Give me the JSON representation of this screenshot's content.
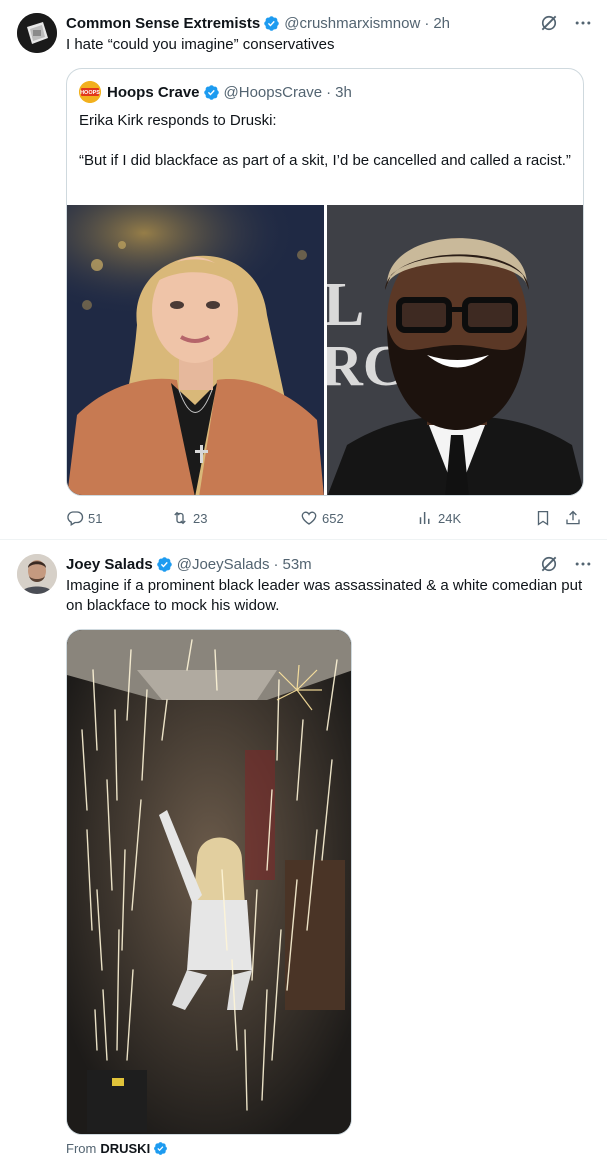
{
  "colors": {
    "verified": "#1d9bf0",
    "secondary_text": "#536471",
    "border": "#cfd9de"
  },
  "tweets": [
    {
      "author_name": "Common Sense Extremists",
      "handle": "@crushmarxismnow",
      "time": "2h",
      "text": "I hate “could you imagine” conservatives",
      "quote": {
        "author_name": "Hoops Crave",
        "handle": "@HoopsCrave",
        "time": "3h",
        "avatar_text": "HOOPS",
        "text_line1": "Erika Kirk responds to Druski:",
        "text_line2": "“But if I did blackface as part of a skit, I’d be cancelled and called a racist.”"
      },
      "stats": {
        "replies": "51",
        "reposts": "23",
        "likes": "652",
        "views": "24K"
      }
    },
    {
      "author_name": "Joey Salads",
      "handle": "@JoeySalads",
      "time": "53m",
      "text": "Imagine if a prominent black leader was assassinated & a white comedian put on blackface to mock his widow.",
      "from_label": "From",
      "from_source": "DRUSKI"
    }
  ],
  "icons": {
    "verified": "verified-badge-icon",
    "grok": "grok-icon",
    "more": "more-icon",
    "reply": "reply-icon",
    "repost": "repost-icon",
    "like": "heart-icon",
    "views": "views-chart-icon",
    "bookmark": "bookmark-icon",
    "share": "share-icon"
  }
}
